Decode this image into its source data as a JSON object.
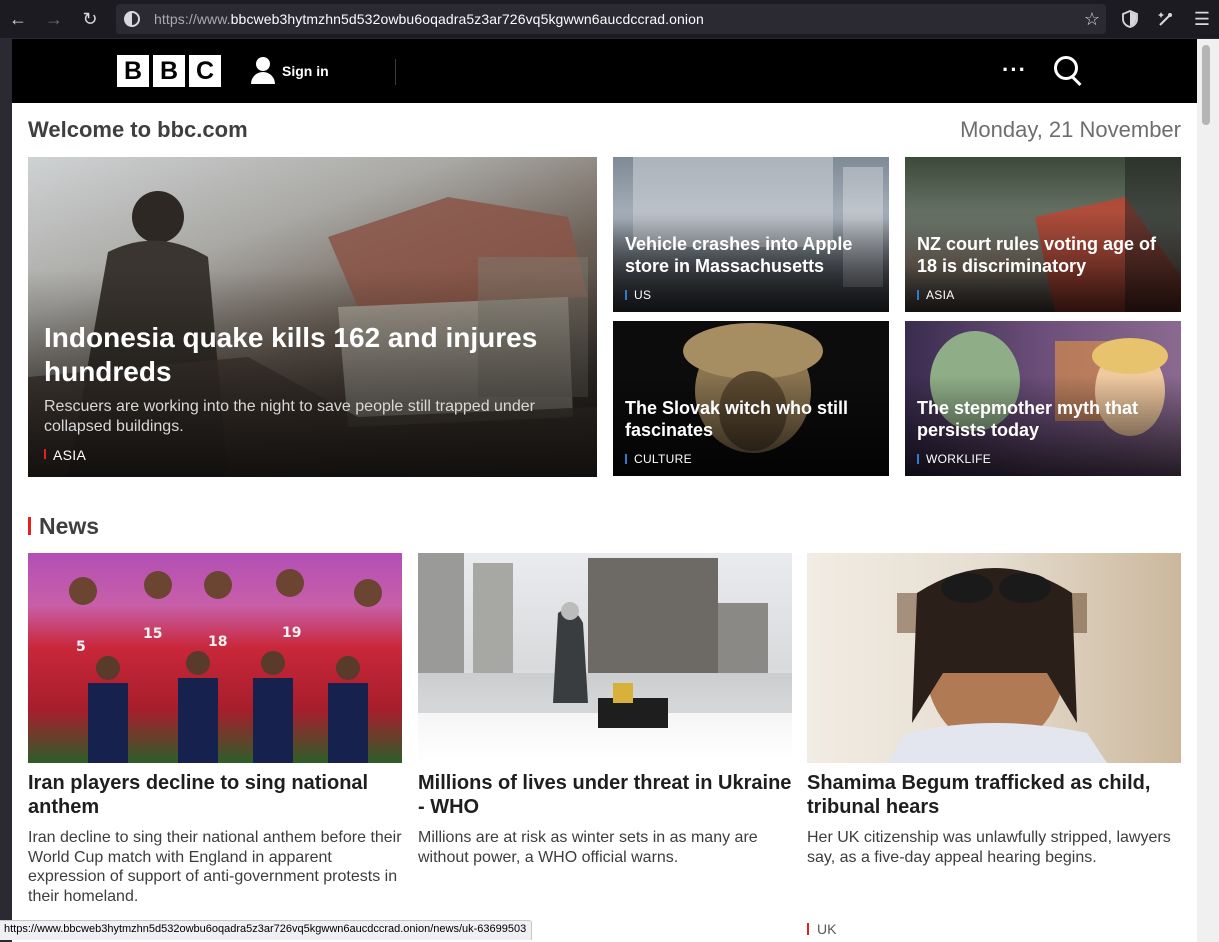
{
  "browser": {
    "url_prefix": "https://www.",
    "url_host": "bbcweb3hytmzhn5d532owbu6oqadra5z3ar726vq5kgwwn6aucdccrad.onion",
    "status_url": "https://www.bbcweb3hytmzhn5d532owbu6oqadra5z3ar726vq5kgwwn6aucdccrad.onion/news/uk-63699503"
  },
  "masthead": {
    "logo_letters": [
      "B",
      "B",
      "C"
    ],
    "signin_label": "Sign in",
    "more_label": "···"
  },
  "welcome": {
    "title": "Welcome to bbc.com",
    "date": "Monday, 21 November"
  },
  "hero": {
    "title": "Indonesia quake kills 162 and injures hundreds",
    "summary": "Rescuers are working into the night to save people still trapped under collapsed buildings.",
    "tag": "ASIA"
  },
  "promos": [
    {
      "title": "Vehicle crashes into Apple store in Massachusetts",
      "tag": "US"
    },
    {
      "title": "NZ court rules voting age of 18 is discriminatory",
      "tag": "ASIA"
    },
    {
      "title": "The Slovak witch who still fascinates",
      "tag": "CULTURE"
    },
    {
      "title": "The stepmother myth that persists today",
      "tag": "WORKLIFE"
    }
  ],
  "news": {
    "section_title": "News",
    "items": [
      {
        "headline": "Iran players decline to sing national anthem",
        "summary": "Iran decline to sing their national anthem before their World Cup match with England in apparent expression of support of anti-government protests in their homeland.",
        "tag": ""
      },
      {
        "headline": "Millions of lives under threat in Ukraine - WHO",
        "summary": "Millions are at risk as winter sets in as many are without power, a WHO official warns.",
        "tag": ""
      },
      {
        "headline": "Shamima Begum trafficked as child, tribunal hears",
        "summary": "Her UK citizenship was unlawfully stripped, lawyers say, as a five-day appeal hearing begins.",
        "tag": "UK"
      }
    ],
    "shirt_numbers": [
      "5",
      "15",
      "18",
      "19"
    ]
  },
  "colors": {
    "bbc_red": "#e0241a",
    "tag_blue": "#2e7ad1",
    "masthead": "#000000"
  }
}
